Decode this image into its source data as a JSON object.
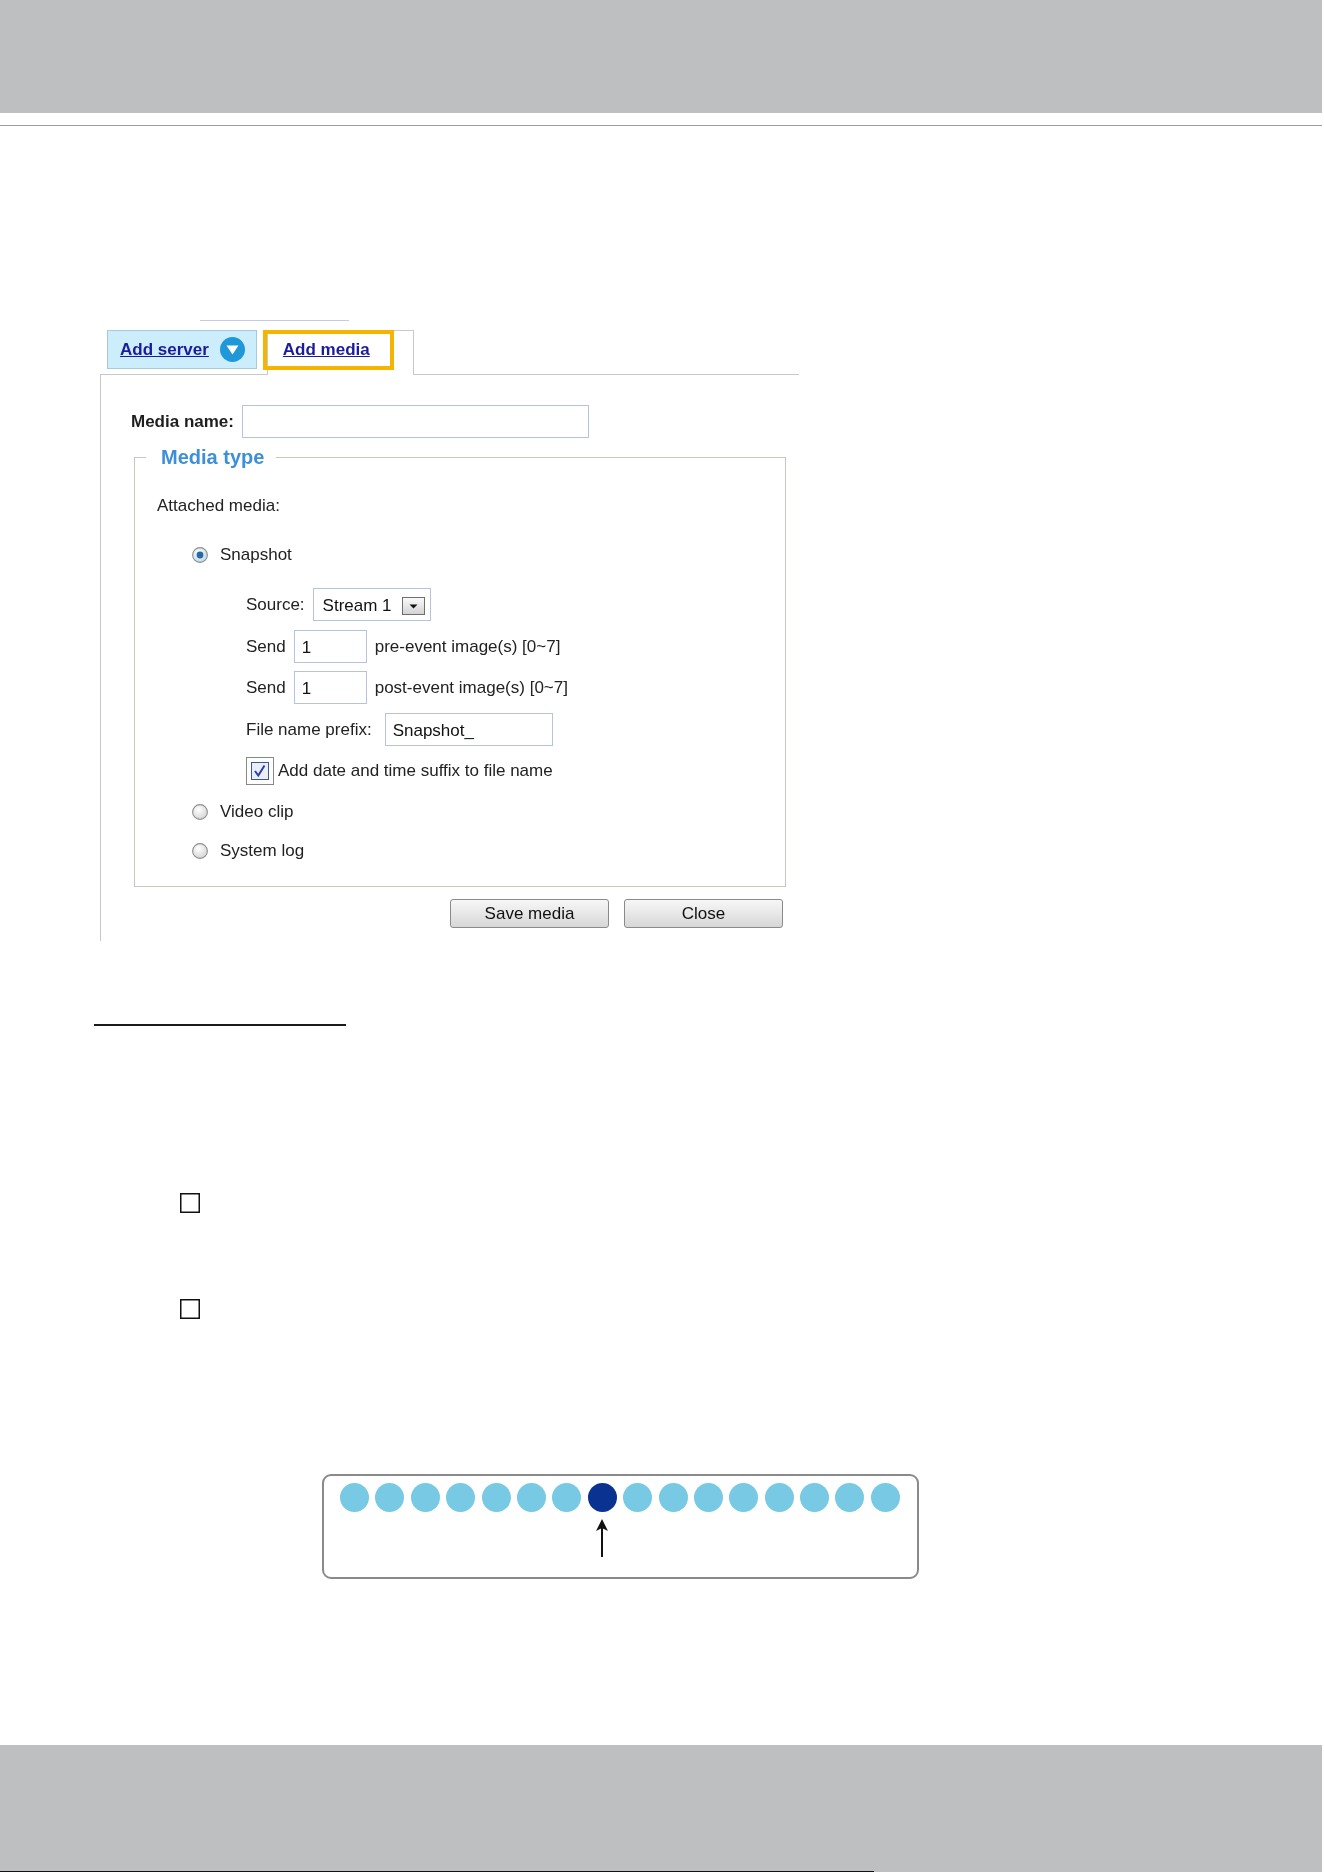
{
  "form": {
    "tabs": [
      {
        "label": "Add server",
        "kind": "menu",
        "selected": false,
        "highlighted": false
      },
      {
        "label": "Add media",
        "kind": "plain",
        "selected": true,
        "highlighted": true
      }
    ],
    "media_name": {
      "label": "Media name:"
    },
    "media_type": {
      "legend": "Media type",
      "prompt": "Attached media:",
      "options": [
        {
          "label": "Snapshot",
          "selected": true,
          "settings": {
            "source": {
              "label": "Source:",
              "value": "Stream 1"
            },
            "counts": [
              {
                "label": "Send",
                "value": "1",
                "suffix": "pre-event image(s) [0~7]"
              },
              {
                "label": "Send",
                "value": "1",
                "suffix": "post-event image(s) [0~7]"
              }
            ],
            "prefix": {
              "label": "File name prefix:",
              "value": "Snapshot_"
            },
            "date_suffix": {
              "label": "Add date and time suffix to file name",
              "checked": true,
              "focused": true
            }
          }
        },
        {
          "label": "Video clip",
          "selected": false
        },
        {
          "label": "System log",
          "selected": false
        }
      ]
    },
    "buttons": [
      "Save media",
      "Close"
    ]
  },
  "bullets": [
    {
      "checked": false
    },
    {
      "checked": false
    }
  ],
  "diagram": {
    "dots": [
      {
        "selected": false
      },
      {
        "selected": false
      },
      {
        "selected": false
      },
      {
        "selected": false
      },
      {
        "selected": false
      },
      {
        "selected": false
      },
      {
        "selected": false
      },
      {
        "selected": true
      },
      {
        "selected": false
      },
      {
        "selected": false
      },
      {
        "selected": false
      },
      {
        "selected": false
      },
      {
        "selected": false
      },
      {
        "selected": false
      },
      {
        "selected": false
      },
      {
        "selected": false
      }
    ]
  }
}
